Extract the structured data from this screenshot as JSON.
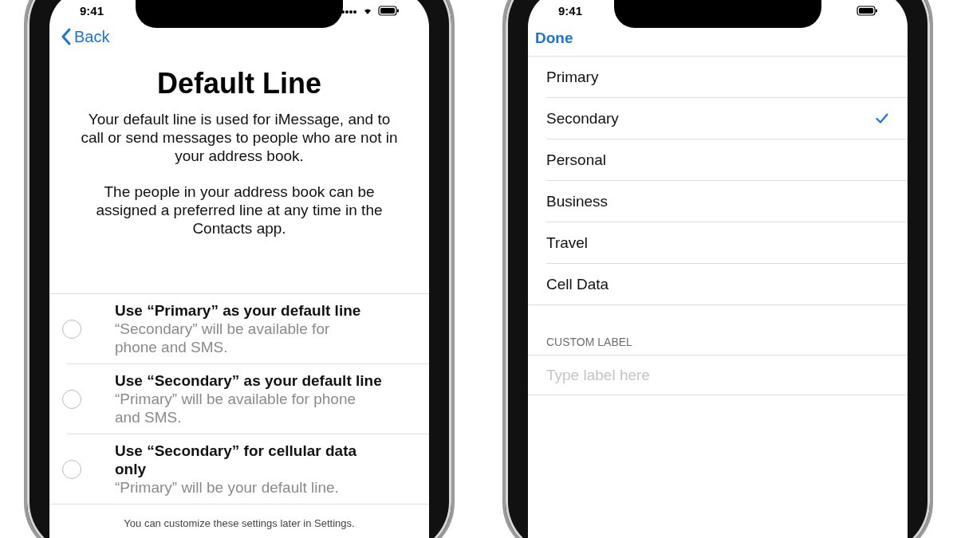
{
  "left_screen": {
    "status_bar": {
      "time": "9:41"
    },
    "back_button": {
      "label": "Back"
    },
    "title": "Default Line",
    "paragraphs": [
      "Your default line is used for iMessage, and to call or send messages to people who are not in your address book.",
      "The people in your address book can be assigned a preferred line at any time in the Contacts app."
    ],
    "options": [
      {
        "title": "Use “Primary” as your default line",
        "subtitle": "“Secondary” will be available for phone and SMS.",
        "selected": false
      },
      {
        "title": "Use “Secondary” as your default line",
        "subtitle": "“Primary” will be available for phone and SMS.",
        "selected": false
      },
      {
        "title": "Use “Secondary” for cellular data only",
        "subtitle": "“Primary” will be your default line.",
        "selected": false
      }
    ],
    "footer": "You can customize these settings later in Settings."
  },
  "right_screen": {
    "status_bar": {
      "time": "9:41"
    },
    "done_button": {
      "label": "Done"
    },
    "labels": [
      {
        "label": "Primary",
        "selected": false
      },
      {
        "label": "Secondary",
        "selected": true
      },
      {
        "label": "Personal",
        "selected": false
      },
      {
        "label": "Business",
        "selected": false
      },
      {
        "label": "Travel",
        "selected": false
      },
      {
        "label": "Cell Data",
        "selected": false
      }
    ],
    "custom_label": {
      "header": "CUSTOM LABEL",
      "placeholder": "Type label here"
    }
  }
}
